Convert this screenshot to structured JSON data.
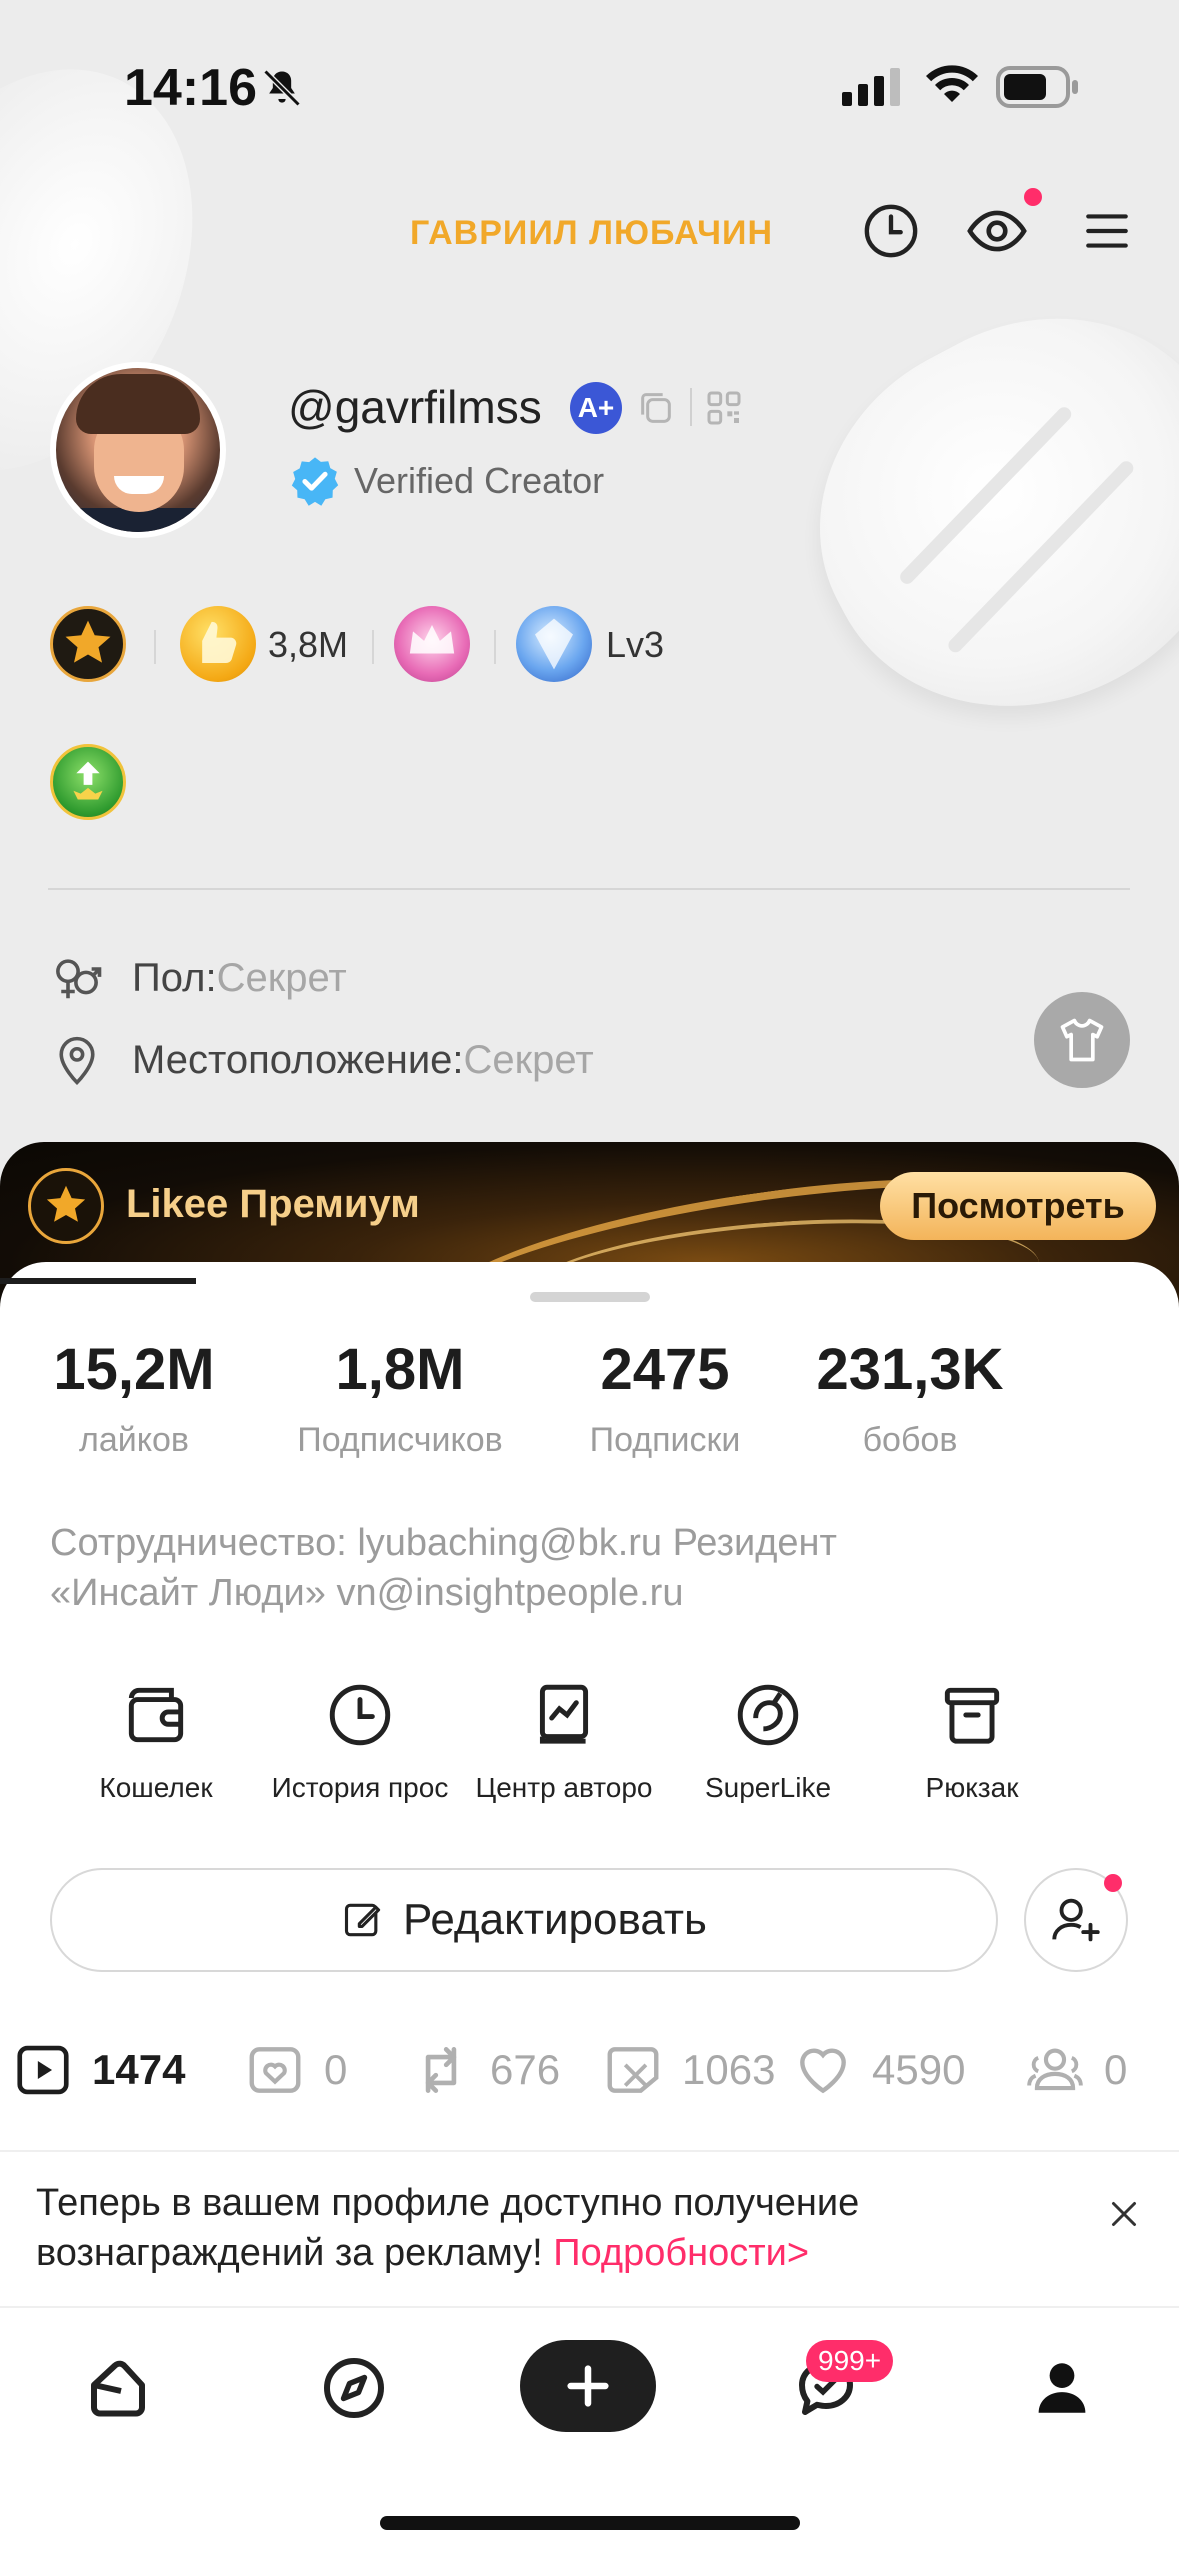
{
  "status_bar": {
    "time": "14:16"
  },
  "header": {
    "display_name": "ГАВРИИЛ ЛЮБАЧИН"
  },
  "profile": {
    "username": "@gavrfilmss",
    "a_plus_badge": "A+",
    "verified_label": "Verified Creator"
  },
  "badges": {
    "likes_count": "3,8M",
    "level": "Lv3"
  },
  "info": {
    "gender_key": "Пол:",
    "gender_value": "Секрет",
    "location_key": "Местоположение:",
    "location_value": "Секрет"
  },
  "premium": {
    "title": "Likee Премиум",
    "button": "Посмотреть"
  },
  "stats": [
    {
      "value": "15,2M",
      "label": "лайков"
    },
    {
      "value": "1,8M",
      "label": "Подписчиков"
    },
    {
      "value": "2475",
      "label": "Подписки"
    },
    {
      "value": "231,3K",
      "label": "бобов"
    }
  ],
  "bio": {
    "line1": "Сотрудничество: lyubaching@bk.ru Резидент",
    "line2": "«Инсайт Люди» vn@insightpeople.ru"
  },
  "tools": [
    {
      "label": "Кошелек",
      "icon": "wallet-icon"
    },
    {
      "label": "История прос",
      "icon": "history-icon"
    },
    {
      "label": "Центр авторо",
      "icon": "creator-center-icon"
    },
    {
      "label": "SuperLike",
      "icon": "superlike-icon"
    },
    {
      "label": "Рюкзак",
      "icon": "backpack-icon"
    }
  ],
  "actions": {
    "edit_label": "Редактировать"
  },
  "tabs": [
    {
      "count": "1474",
      "icon": "videos-icon"
    },
    {
      "count": "0",
      "icon": "liked-card-icon"
    },
    {
      "count": "676",
      "icon": "repost-icon"
    },
    {
      "count": "1063",
      "icon": "hidden-icon"
    },
    {
      "count": "4590",
      "icon": "heart-icon"
    },
    {
      "count": "0",
      "icon": "group-icon"
    }
  ],
  "notice": {
    "text": "Теперь в вашем профиле доступно получение вознаграждений за рекламу! ",
    "link": "Подробности>"
  },
  "bottom_nav": {
    "messages_badge": "999+"
  },
  "colors": {
    "accent": "#f1a829",
    "pink": "#ff2d6a",
    "premium_gold": "#f3b45a"
  }
}
